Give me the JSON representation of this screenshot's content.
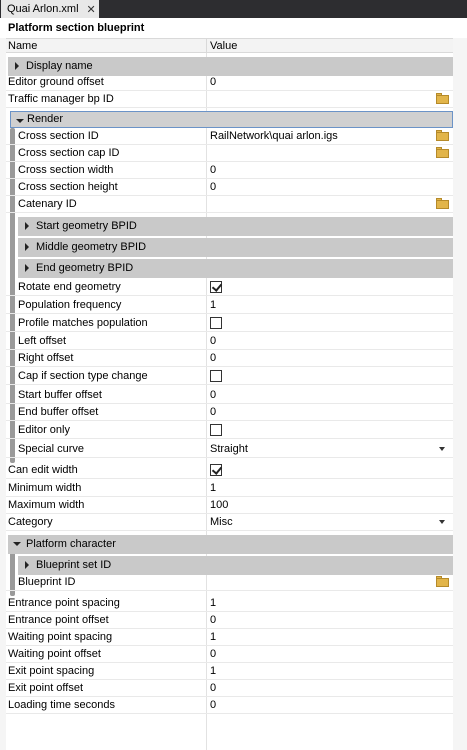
{
  "tab": {
    "title": "Quai Arlon.xml",
    "close": "✕"
  },
  "panel_title": "Platform section blueprint",
  "columns": {
    "name": "Name",
    "value": "Value"
  },
  "rows": {
    "display_name": "Display name",
    "editor_ground_offset": {
      "name": "Editor ground offset",
      "value": "0"
    },
    "traffic_manager_bp_id": {
      "name": "Traffic manager bp ID",
      "value": ""
    },
    "render": "Render",
    "cross_section_id": {
      "name": "Cross section ID",
      "value": "RailNetwork\\quai arlon.igs"
    },
    "cross_section_cap_id": {
      "name": "Cross section cap ID",
      "value": ""
    },
    "cross_section_width": {
      "name": "Cross section width",
      "value": "0"
    },
    "cross_section_height": {
      "name": "Cross section height",
      "value": "0"
    },
    "catenary_id": {
      "name": "Catenary ID",
      "value": ""
    },
    "start_geometry": "Start geometry BPID",
    "middle_geometry": "Middle geometry BPID",
    "end_geometry": "End geometry BPID",
    "rotate_end_geometry": {
      "name": "Rotate end geometry",
      "checked": true
    },
    "population_frequency": {
      "name": "Population frequency",
      "value": "1"
    },
    "profile_matches_population": {
      "name": "Profile matches population",
      "checked": false
    },
    "left_offset": {
      "name": "Left offset",
      "value": "0"
    },
    "right_offset": {
      "name": "Right offset",
      "value": "0"
    },
    "cap_if_section_type_change": {
      "name": "Cap if section type change",
      "checked": false
    },
    "start_buffer_offset": {
      "name": "Start buffer offset",
      "value": "0"
    },
    "end_buffer_offset": {
      "name": "End buffer offset",
      "value": "0"
    },
    "editor_only": {
      "name": "Editor only",
      "checked": false
    },
    "special_curve": {
      "name": "Special curve",
      "value": "Straight"
    },
    "can_edit_width": {
      "name": "Can edit width",
      "checked": true
    },
    "minimum_width": {
      "name": "Minimum width",
      "value": "1"
    },
    "maximum_width": {
      "name": "Maximum width",
      "value": "100"
    },
    "category": {
      "name": "Category",
      "value": "Misc"
    },
    "platform_character": "Platform character",
    "blueprint_set_id": "Blueprint set ID",
    "blueprint_id": {
      "name": "Blueprint ID",
      "value": ""
    },
    "entrance_point_spacing": {
      "name": "Entrance point spacing",
      "value": "1"
    },
    "entrance_point_offset": {
      "name": "Entrance point offset",
      "value": "0"
    },
    "waiting_point_spacing": {
      "name": "Waiting point spacing",
      "value": "1"
    },
    "waiting_point_offset": {
      "name": "Waiting point offset",
      "value": "0"
    },
    "exit_point_spacing": {
      "name": "Exit point spacing",
      "value": "1"
    },
    "exit_point_offset": {
      "name": "Exit point offset",
      "value": "0"
    },
    "loading_time_seconds": {
      "name": "Loading time seconds",
      "value": "0"
    }
  },
  "icons": {
    "folder": "folder-icon",
    "expand": "triangle-icon",
    "dropdown": "chevron-down-icon",
    "check": "checkmark-icon"
  },
  "colors": {
    "tab_bar": "#2d2d30",
    "group_header": "#c9c9c9",
    "selection_border": "#6b93c7",
    "folder": "#e2b54a"
  }
}
